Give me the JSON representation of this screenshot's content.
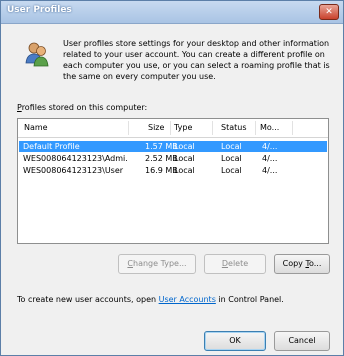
{
  "window": {
    "title": "User Profiles",
    "close_label": "✕"
  },
  "info": {
    "icon": "users-icon",
    "text": "User profiles store settings for your desktop and other information related to your user account. You can create a different profile on each computer you use, or you can select a roaming profile that is the same on every computer you use."
  },
  "list": {
    "label_hotkey": "P",
    "label_rest": "rofiles stored on this computer:",
    "columns": [
      "Name",
      "Size",
      "Type",
      "Status",
      "Mo..."
    ],
    "rows": [
      {
        "name": "Default Profile",
        "size": "1.57 MB",
        "type": "Local",
        "status": "Local",
        "modified": "4/...",
        "selected": true
      },
      {
        "name": "WES008064123123\\Admi...",
        "size": "2.52 MB",
        "type": "Local",
        "status": "Local",
        "modified": "4/...",
        "selected": false
      },
      {
        "name": "WES008064123123\\User",
        "size": "16.9 MB",
        "type": "Local",
        "status": "Local",
        "modified": "4/...",
        "selected": false
      }
    ]
  },
  "buttons": {
    "change_type_hotkey": "C",
    "change_type_rest": "hange Type...",
    "delete_hotkey": "D",
    "delete_rest": "elete",
    "copy_to_prefix": "Copy ",
    "copy_to_hotkey": "T",
    "copy_to_rest": "o...",
    "ok": "OK",
    "cancel": "Cancel"
  },
  "footer": {
    "text_before": "To create new user accounts, open ",
    "link": "User Accounts",
    "text_after": " in Control Panel."
  }
}
